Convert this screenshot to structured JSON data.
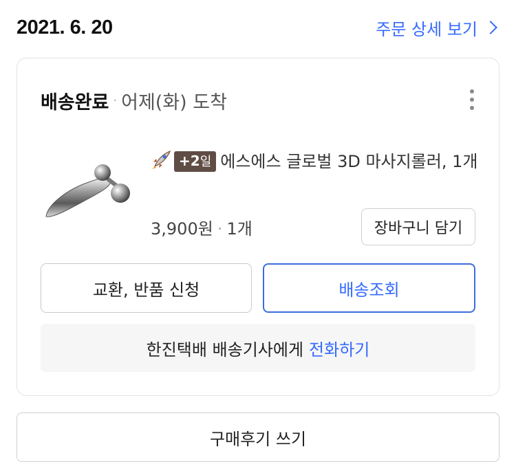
{
  "order": {
    "date": "2021. 6. 20",
    "detail_link_label": "주문 상세 보기"
  },
  "delivery": {
    "status": "배송완료",
    "separator": "·",
    "arrival": "어제(화) 도착"
  },
  "product": {
    "badge_value": "+2",
    "badge_unit": "일",
    "name": "에스에스 글로벌 3D 마사지롤러, 1개",
    "price": "3,900원",
    "quantity": "1개"
  },
  "buttons": {
    "cart": "장바구니 담기",
    "exchange_return": "교환, 반품 신청",
    "track": "배송조회",
    "review": "구매후기 쓰기"
  },
  "call": {
    "text": "한진택배 배송기사에게",
    "link": "전화하기"
  },
  "colors": {
    "accent_blue": "#346aff",
    "badge_brown": "#5f4d45"
  }
}
